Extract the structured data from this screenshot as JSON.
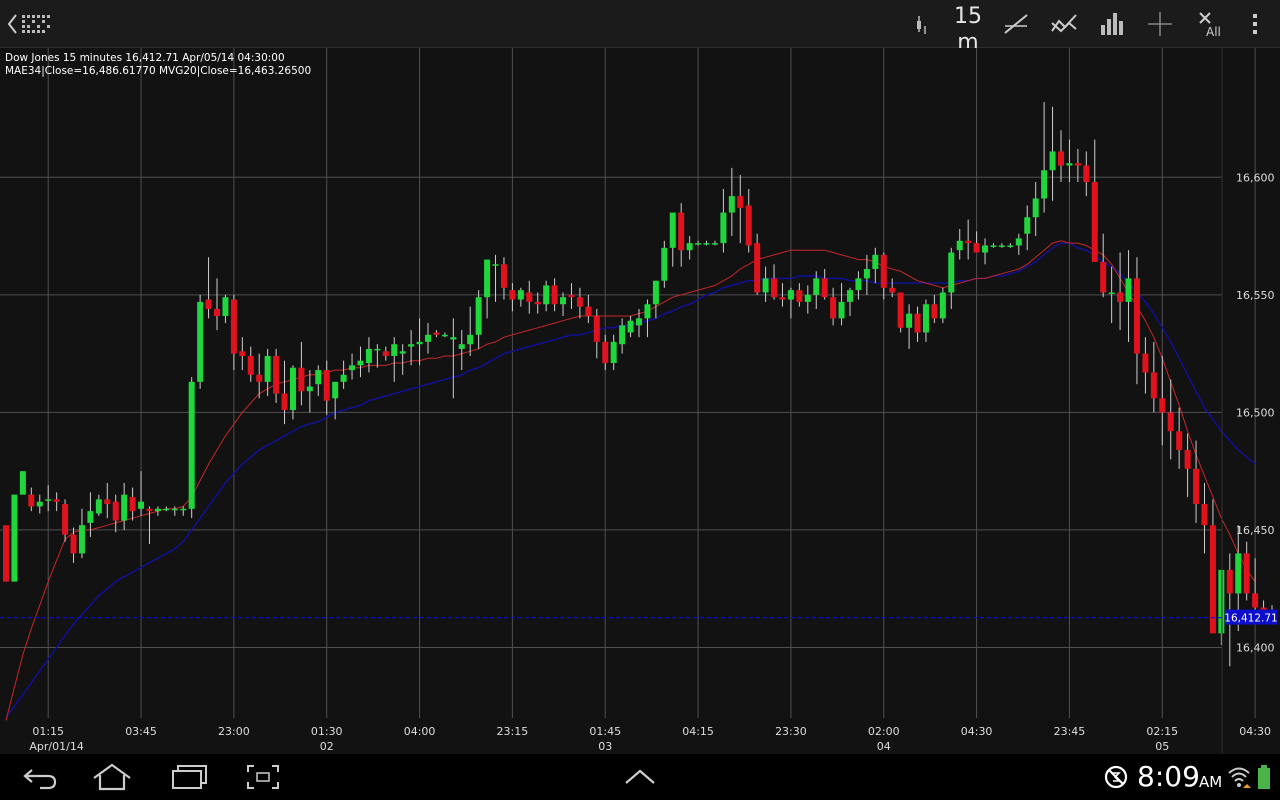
{
  "toolbar": {
    "interval_label": "15 m",
    "all_label": "All",
    "icons": [
      "back-icon",
      "app-logo-icon",
      "candlestick-type-icon",
      "interval-icon",
      "trendline-icon",
      "indicator-icon",
      "volume-bars-icon",
      "crosshair-icon",
      "clear-all-icon",
      "overflow-menu-icon"
    ]
  },
  "info": {
    "line1": "Dow Jones 15 minutes 16,412.71 Apr/05/14 04:30:00",
    "line2": "MAE34|Close=16,486.61770 MVG20|Close=16,463.26500"
  },
  "status_bar": {
    "time": "8:09",
    "ampm": "AM",
    "icons": [
      "back-nav-icon",
      "home-nav-icon",
      "recent-apps-icon",
      "screenshot-icon",
      "up-chevron-icon",
      "sync-icon",
      "wifi-icon",
      "battery-icon"
    ]
  },
  "colors": {
    "up": "#1fd63d",
    "down": "#e0121d",
    "mae": "#c62828",
    "mvg": "#1010a0",
    "last_price": "#0d0dcc",
    "grid": "#505050"
  },
  "chart_data": {
    "type": "candlestick",
    "instrument": "Dow Jones",
    "interval": "15 minutes",
    "last_price": 16412.71,
    "last_price_label": "16,412.71",
    "ylim": [
      16370,
      16655
    ],
    "y_ticks": [
      {
        "value": 16400,
        "label": "16,400"
      },
      {
        "value": 16450,
        "label": "16,450"
      },
      {
        "value": 16500,
        "label": "16,500"
      },
      {
        "value": 16550,
        "label": "16,550"
      },
      {
        "value": 16600,
        "label": "16,600"
      }
    ],
    "x_time_ticks": [
      {
        "index": 5,
        "label": "01:15"
      },
      {
        "index": 16,
        "label": "03:45"
      },
      {
        "index": 27,
        "label": "23:00"
      },
      {
        "index": 38,
        "label": "01:30"
      },
      {
        "index": 49,
        "label": "04:00"
      },
      {
        "index": 60,
        "label": "23:15"
      },
      {
        "index": 71,
        "label": "01:45"
      },
      {
        "index": 82,
        "label": "04:15"
      },
      {
        "index": 93,
        "label": "23:30"
      },
      {
        "index": 104,
        "label": "02:00"
      },
      {
        "index": 115,
        "label": "04:30"
      },
      {
        "index": 126,
        "label": "23:45"
      },
      {
        "index": 137,
        "label": "02:15"
      },
      {
        "index": 148,
        "label": "04:30"
      }
    ],
    "x_date_labels": [
      {
        "index": 6,
        "label": "Apr/01/14"
      },
      {
        "index": 38,
        "label": "02"
      },
      {
        "index": 71,
        "label": "03"
      },
      {
        "index": 104,
        "label": "04"
      },
      {
        "index": 137,
        "label": "05"
      }
    ],
    "candles": [
      [
        16452,
        16451,
        16428,
        16428
      ],
      [
        16428,
        16428,
        16465,
        16465
      ],
      [
        16465,
        16465,
        16465,
        16475
      ],
      [
        16465,
        16468,
        16458,
        16460
      ],
      [
        16460,
        16465,
        16457,
        16462
      ],
      [
        16463,
        16469,
        16458,
        16463
      ],
      [
        16463,
        16466,
        16458,
        16462
      ],
      [
        16461,
        16463,
        16445,
        16448
      ],
      [
        16448,
        16451,
        16436,
        16440
      ],
      [
        16440,
        16459,
        16438,
        16452
      ],
      [
        16453,
        16466,
        16447,
        16458
      ],
      [
        16457,
        16465,
        16456,
        16463
      ],
      [
        16463,
        16470,
        16455,
        16461
      ],
      [
        16462,
        16465,
        16449,
        16454
      ],
      [
        16454,
        16470,
        16450,
        16465
      ],
      [
        16464,
        16468,
        16454,
        16458
      ],
      [
        16459,
        16475,
        16456,
        16462
      ],
      [
        16459,
        16460,
        16444,
        16458
      ],
      [
        16458,
        16460,
        16456,
        16459
      ],
      [
        16459,
        16460,
        16458,
        16459
      ],
      [
        16459,
        16460,
        16456,
        16459
      ],
      [
        16459,
        16460,
        16456,
        16459
      ],
      [
        16459,
        16515,
        16455,
        16513
      ],
      [
        16513,
        16550,
        16510,
        16547
      ],
      [
        16548,
        16566,
        16540,
        16544
      ],
      [
        16544,
        16557,
        16535,
        16541
      ],
      [
        16541,
        16550,
        16538,
        16549
      ],
      [
        16548,
        16550,
        16518,
        16525
      ],
      [
        16526,
        16532,
        16518,
        16524
      ],
      [
        16524,
        16528,
        16513,
        16516
      ],
      [
        16516,
        16525,
        16506,
        16513
      ],
      [
        16513,
        16527,
        16507,
        16524
      ],
      [
        16524,
        16527,
        16504,
        16508
      ],
      [
        16508,
        16522,
        16495,
        16501
      ],
      [
        16501,
        16520,
        16497,
        16519
      ],
      [
        16519,
        16530,
        16503,
        16509
      ],
      [
        16509,
        16518,
        16500,
        16511
      ],
      [
        16512,
        16520,
        16507,
        16518
      ],
      [
        16518,
        16522,
        16499,
        16505
      ],
      [
        16506,
        16513,
        16497,
        16513
      ],
      [
        16513,
        16522,
        16510,
        16516
      ],
      [
        16518,
        16525,
        16514,
        16520
      ],
      [
        16520,
        16528,
        16515,
        16522
      ],
      [
        16521,
        16532,
        16517,
        16527
      ],
      [
        16527,
        16529,
        16519,
        16527
      ],
      [
        16526,
        16528,
        16522,
        16524
      ],
      [
        16524,
        16532,
        16513,
        16529
      ],
      [
        16525,
        16529,
        16516,
        16526
      ],
      [
        16528,
        16535,
        16520,
        16529
      ],
      [
        16529,
        16540,
        16520,
        16530
      ],
      [
        16530,
        16538,
        16525,
        16533
      ],
      [
        16534,
        16535,
        16532,
        16533
      ],
      [
        16533,
        16534,
        16532,
        16533
      ],
      [
        16531,
        16540,
        16506,
        16532
      ],
      [
        16527,
        16535,
        16518,
        16529
      ],
      [
        16529,
        16545,
        16524,
        16533
      ],
      [
        16533,
        16552,
        16527,
        16549
      ],
      [
        16549,
        16565,
        16540,
        16565
      ],
      [
        16563,
        16567,
        16547,
        16563
      ],
      [
        16563,
        16566,
        16548,
        16553
      ],
      [
        16552,
        16555,
        16543,
        16548
      ],
      [
        16548,
        16553,
        16545,
        16552
      ],
      [
        16551,
        16556,
        16542,
        16547
      ],
      [
        16547,
        16551,
        16542,
        16546
      ],
      [
        16546,
        16556,
        16543,
        16554
      ],
      [
        16554,
        16557,
        16543,
        16546
      ],
      [
        16546,
        16551,
        16541,
        16549
      ],
      [
        16550,
        16555,
        16544,
        16549
      ],
      [
        16549,
        16553,
        16540,
        16545
      ],
      [
        16545,
        16550,
        16538,
        16541
      ],
      [
        16541,
        16544,
        16523,
        16530
      ],
      [
        16530,
        16533,
        16518,
        16521
      ],
      [
        16521,
        16533,
        16518,
        16530
      ],
      [
        16529,
        16540,
        16525,
        16537
      ],
      [
        16534,
        16541,
        16532,
        16539
      ],
      [
        16537,
        16544,
        16532,
        16540
      ],
      [
        16540,
        16548,
        16532,
        16546
      ],
      [
        16546,
        16556,
        16540,
        16556
      ],
      [
        16556,
        16573,
        16553,
        16570
      ],
      [
        16570,
        16582,
        16562,
        16585
      ],
      [
        16585,
        16589,
        16562,
        16569
      ],
      [
        16569,
        16575,
        16565,
        16572
      ],
      [
        16572,
        16573,
        16571,
        16572
      ],
      [
        16572,
        16573,
        16571,
        16572
      ],
      [
        16572,
        16573,
        16571,
        16572
      ],
      [
        16572,
        16595,
        16568,
        16585
      ],
      [
        16585,
        16604,
        16575,
        16592
      ],
      [
        16592,
        16601,
        16572,
        16587
      ],
      [
        16588,
        16595,
        16568,
        16571
      ],
      [
        16572,
        16576,
        16550,
        16551
      ],
      [
        16551,
        16562,
        16547,
        16557
      ],
      [
        16557,
        16563,
        16548,
        16549
      ],
      [
        16549,
        16555,
        16545,
        16548
      ],
      [
        16548,
        16553,
        16540,
        16552
      ],
      [
        16552,
        16555,
        16545,
        16547
      ],
      [
        16547,
        16554,
        16542,
        16550
      ],
      [
        16550,
        16560,
        16544,
        16557
      ],
      [
        16557,
        16561,
        16548,
        16549
      ],
      [
        16549,
        16553,
        16537,
        16540
      ],
      [
        16540,
        16555,
        16537,
        16547
      ],
      [
        16547,
        16553,
        16541,
        16552
      ],
      [
        16552,
        16560,
        16548,
        16557
      ],
      [
        16557,
        16567,
        16550,
        16561
      ],
      [
        16561,
        16570,
        16555,
        16567
      ],
      [
        16567,
        16568,
        16548,
        16553
      ],
      [
        16553,
        16557,
        16549,
        16551
      ],
      [
        16551,
        16550,
        16534,
        16536
      ],
      [
        16536,
        16546,
        16527,
        16542
      ],
      [
        16542,
        16545,
        16530,
        16534
      ],
      [
        16534,
        16548,
        16530,
        16546
      ],
      [
        16546,
        16550,
        16538,
        16540
      ],
      [
        16540,
        16553,
        16538,
        16551
      ],
      [
        16551,
        16570,
        16544,
        16568
      ],
      [
        16569,
        16578,
        16565,
        16573
      ],
      [
        16573,
        16582,
        16565,
        16572
      ],
      [
        16572,
        16577,
        16568,
        16568
      ],
      [
        16568,
        16574,
        16563,
        16571
      ],
      [
        16571,
        16572,
        16570,
        16571
      ],
      [
        16571,
        16572,
        16570,
        16571
      ],
      [
        16571,
        16572,
        16570,
        16571
      ],
      [
        16571,
        16576,
        16567,
        16574
      ],
      [
        16576,
        16588,
        16569,
        16583
      ],
      [
        16583,
        16598,
        16575,
        16591
      ],
      [
        16591,
        16632,
        16585,
        16603
      ],
      [
        16603,
        16630,
        16590,
        16611
      ],
      [
        16611,
        16620,
        16598,
        16605
      ],
      [
        16605,
        16616,
        16598,
        16606
      ],
      [
        16606,
        16612,
        16598,
        16605
      ],
      [
        16605,
        16611,
        16592,
        16598
      ],
      [
        16598,
        16616,
        16575,
        16564
      ],
      [
        16564,
        16576,
        16549,
        16551
      ],
      [
        16551,
        16562,
        16538,
        16551
      ],
      [
        16551,
        16568,
        16535,
        16547
      ],
      [
        16547,
        16569,
        16530,
        16557
      ],
      [
        16557,
        16566,
        16512,
        16525
      ],
      [
        16525,
        16532,
        16508,
        16517
      ],
      [
        16517,
        16530,
        16500,
        16506
      ],
      [
        16506,
        16524,
        16486,
        16500
      ],
      [
        16500,
        16514,
        16480,
        16492
      ],
      [
        16492,
        16502,
        16476,
        16484
      ],
      [
        16484,
        16491,
        16464,
        16476
      ],
      [
        16476,
        16488,
        16453,
        16461
      ],
      [
        16461,
        16470,
        16440,
        16452
      ],
      [
        16452,
        16463,
        16430,
        16406
      ],
      [
        16406,
        16430,
        16401,
        16433
      ],
      [
        16433,
        16440,
        16392,
        16423
      ],
      [
        16423,
        16452,
        16407,
        16440
      ],
      [
        16440,
        16445,
        16420,
        16423
      ],
      [
        16423,
        16438,
        16410,
        16417
      ],
      [
        16417,
        16420,
        16413,
        16415
      ],
      [
        16415,
        16418,
        16410,
        16413
      ]
    ],
    "mae": [
      16369,
      16383,
      16397,
      16408,
      16418,
      16428,
      16437,
      16446,
      16449,
      16450,
      16450,
      16451,
      16452,
      16453,
      16454,
      16455,
      16456,
      16457,
      16458,
      16459,
      16459,
      16460,
      16464,
      16471,
      16478,
      16484,
      16490,
      16495,
      16500,
      16504,
      16508,
      16510,
      16512,
      16513,
      16514,
      16515,
      16516,
      16516,
      16517,
      16518,
      16518,
      16519,
      16519,
      16520,
      16520,
      16520,
      16521,
      16521,
      16522,
      16522,
      16523,
      16523,
      16524,
      16524,
      16525,
      16526,
      16527,
      16529,
      16530,
      16532,
      16533,
      16534,
      16535,
      16536,
      16537,
      16538,
      16539,
      16540,
      16541,
      16541,
      16541,
      16541,
      16541,
      16541,
      16541,
      16542,
      16543,
      16545,
      16547,
      16549,
      16550,
      16551,
      16552,
      16553,
      16554,
      16556,
      16558,
      16561,
      16563,
      16565,
      16566,
      16567,
      16568,
      16569,
      16569,
      16569,
      16569,
      16569,
      16568,
      16567,
      16566,
      16565,
      16565,
      16564,
      16562,
      16561,
      16560,
      16558,
      16556,
      16555,
      16554,
      16553,
      16554,
      16555,
      16556,
      16557,
      16557,
      16558,
      16559,
      16560,
      16561,
      16563,
      16566,
      16569,
      16572,
      16573,
      16572,
      16572,
      16571,
      16569,
      16567,
      16563,
      16557,
      16551,
      16545,
      16539,
      16532,
      16523,
      16513,
      16503,
      16492,
      16482,
      16473,
      16464,
      16455,
      16448,
      16440,
      16433,
      16428
    ],
    "mvg": [
      16370,
      16375,
      16380,
      16385,
      16390,
      16395,
      16400,
      16405,
      16410,
      16414,
      16418,
      16422,
      16425,
      16428,
      16430,
      16432,
      16434,
      16436,
      16438,
      16440,
      16442,
      16445,
      16450,
      16455,
      16460,
      16465,
      16470,
      16474,
      16478,
      16481,
      16484,
      16486,
      16488,
      16490,
      16492,
      16494,
      16495,
      16496,
      16498,
      16500,
      16501,
      16502,
      16503,
      16505,
      16506,
      16507,
      16508,
      16509,
      16510,
      16511,
      16512,
      16513,
      16514,
      16515,
      16516,
      16518,
      16519,
      16521,
      16523,
      16525,
      16526,
      16527,
      16528,
      16529,
      16530,
      16531,
      16532,
      16533,
      16533,
      16534,
      16535,
      16536,
      16536,
      16537,
      16537,
      16538,
      16539,
      16540,
      16542,
      16543,
      16545,
      16546,
      16548,
      16550,
      16551,
      16553,
      16554,
      16555,
      16556,
      16556,
      16557,
      16557,
      16557,
      16557,
      16558,
      16558,
      16558,
      16557,
      16557,
      16557,
      16556,
      16556,
      16556,
      16555,
      16555,
      16555,
      16555,
      16555,
      16555,
      16555,
      16555,
      16555,
      16555,
      16556,
      16556,
      16557,
      16557,
      16558,
      16558,
      16559,
      16560,
      16562,
      16564,
      16567,
      16570,
      16572,
      16572,
      16570,
      16569,
      16567,
      16564,
      16562,
      16559,
      16555,
      16551,
      16547,
      16542,
      16536,
      16530,
      16523,
      16516,
      16509,
      16502,
      16497,
      16492,
      16488,
      16484,
      16481,
      16478
    ]
  }
}
